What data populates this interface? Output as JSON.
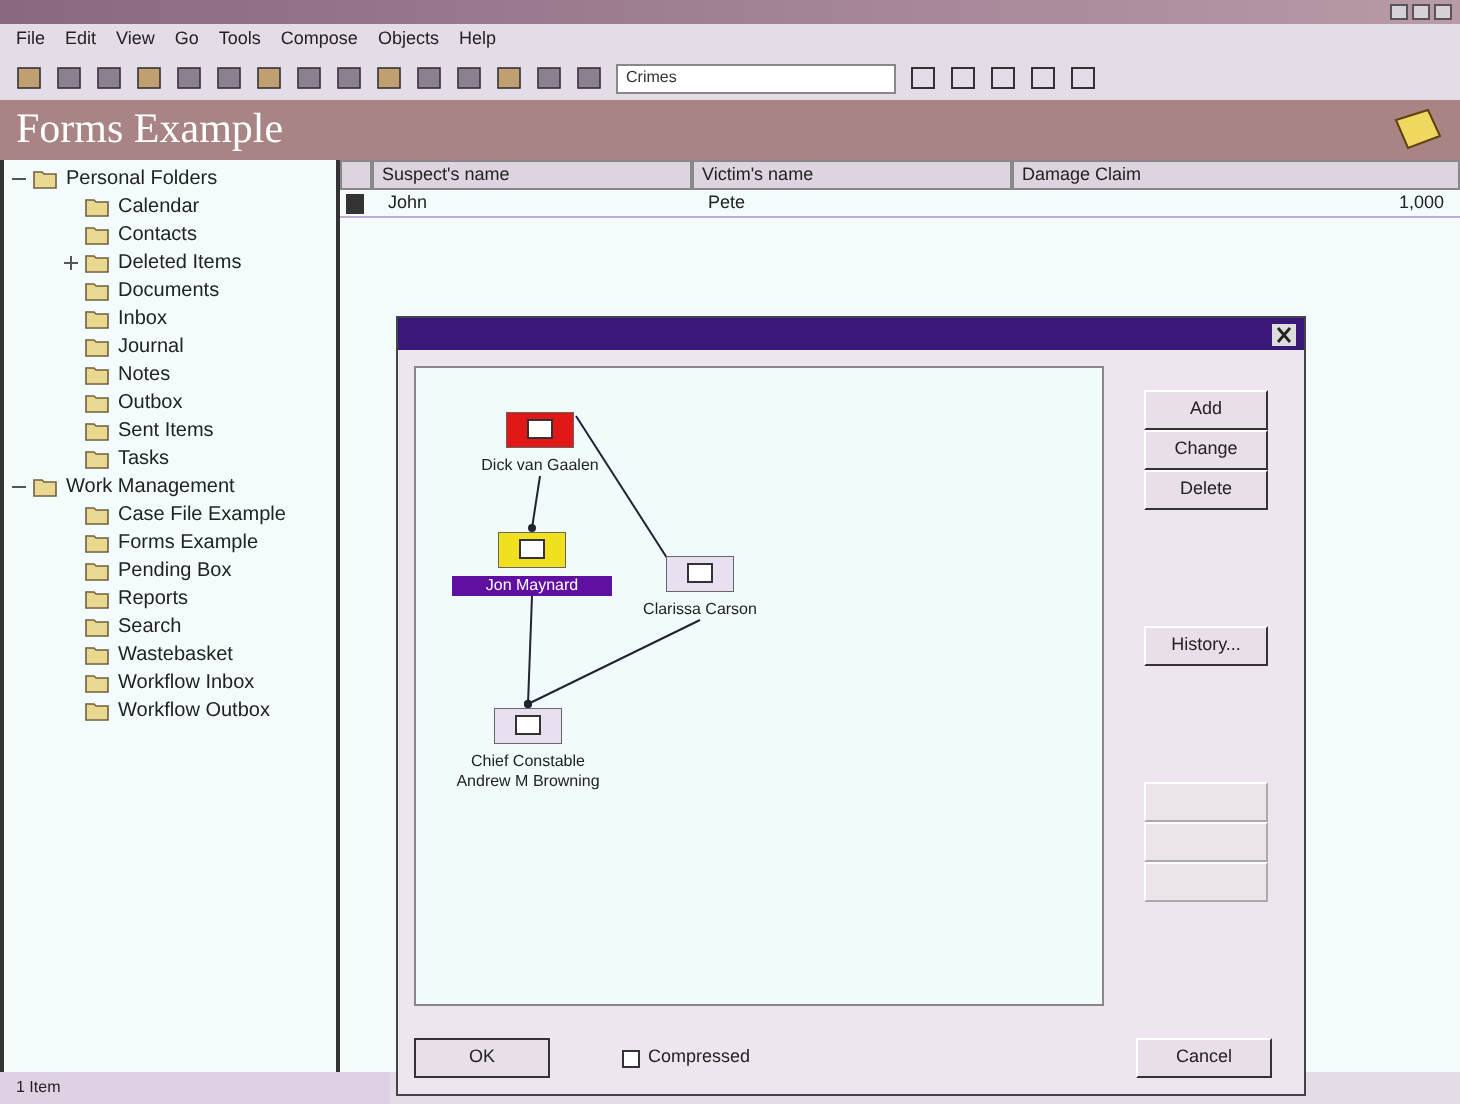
{
  "menu": [
    {
      "label": "File"
    },
    {
      "label": "Edit"
    },
    {
      "label": "View"
    },
    {
      "label": "Go"
    },
    {
      "label": "Tools"
    },
    {
      "label": "Compose"
    },
    {
      "label": "Objects"
    },
    {
      "label": "Help"
    }
  ],
  "toolbar": {
    "folder_combo": "Crimes"
  },
  "banner": {
    "title": "Forms Example"
  },
  "folders": [
    {
      "label": "Personal Folders",
      "expanded": true,
      "children": [
        {
          "label": "Calendar"
        },
        {
          "label": "Contacts"
        },
        {
          "label": "Deleted Items",
          "expanded": false
        },
        {
          "label": "Documents"
        },
        {
          "label": "Inbox"
        },
        {
          "label": "Journal"
        },
        {
          "label": "Notes"
        },
        {
          "label": "Outbox"
        },
        {
          "label": "Sent Items"
        },
        {
          "label": "Tasks"
        }
      ]
    },
    {
      "label": "Work Management",
      "expanded": true,
      "children": [
        {
          "label": "Case File Example"
        },
        {
          "label": "Forms Example"
        },
        {
          "label": "Pending Box"
        },
        {
          "label": "Reports"
        },
        {
          "label": "Search"
        },
        {
          "label": "Wastebasket"
        },
        {
          "label": "Workflow Inbox"
        },
        {
          "label": "Workflow Outbox"
        }
      ]
    }
  ],
  "table": {
    "columns": [
      "Suspect's name",
      "Victim's name",
      "Damage Claim"
    ],
    "rows": [
      {
        "cells": [
          "John",
          "Pete",
          "1,000"
        ]
      }
    ]
  },
  "dialog": {
    "nodes": [
      {
        "label": "Dick van Gaalen",
        "color": "#e01818",
        "selected": false
      },
      {
        "label": "Jon Maynard",
        "color": "#f0e020",
        "selected": true
      },
      {
        "label": "Clarissa Carson",
        "color": "#e8e0f0",
        "selected": false
      },
      {
        "label": "Chief Constable Andrew M Browning",
        "color": "#e8e0f0",
        "selected": false
      }
    ],
    "buttons": [
      {
        "label": "Add",
        "disabled": false
      },
      {
        "label": "Change",
        "disabled": false
      },
      {
        "label": "Delete",
        "disabled": false
      },
      {
        "label": "History...",
        "disabled": false
      },
      {
        "disabled": true
      },
      {
        "disabled": true
      },
      {
        "disabled": true
      }
    ],
    "ok": "OK",
    "compressed": {
      "label": "Compressed",
      "checked": false
    },
    "cancel": "Cancel"
  },
  "status_bar": "1 Item"
}
